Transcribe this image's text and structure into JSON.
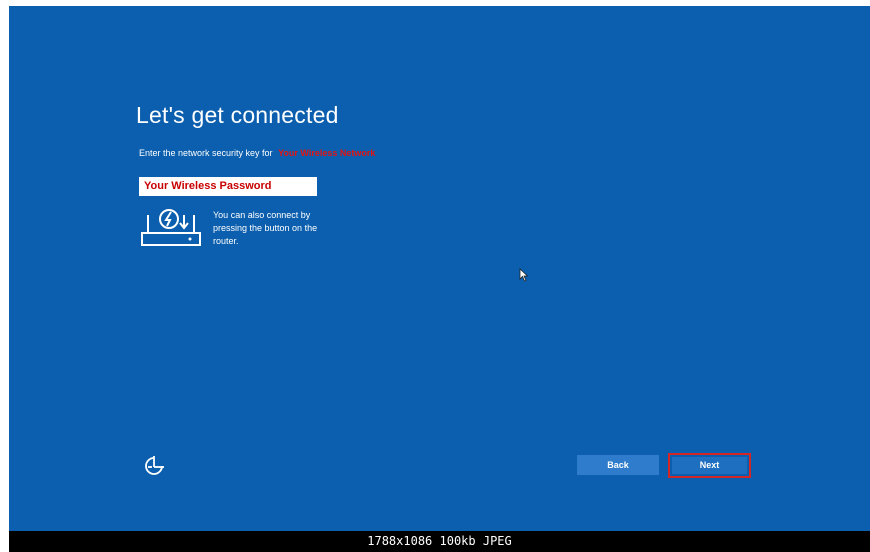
{
  "page": {
    "title": "Let's get connected",
    "subtitle_prefix": "Enter the network security key for",
    "network_name": "Your Wireless Network",
    "password_value": "Your Wireless Password",
    "wps_hint": "You can also connect by pressing the button on the router."
  },
  "buttons": {
    "back_label": "Back",
    "next_label": "Next"
  },
  "icons": {
    "router": "router-wps-icon",
    "accessibility": "accessibility-icon",
    "cursor": "mouse-cursor-icon"
  },
  "footer": {
    "info": "1788x1086 100kb JPEG"
  },
  "colors": {
    "background": "#0b5fae",
    "annotation_red": "#d32626"
  }
}
